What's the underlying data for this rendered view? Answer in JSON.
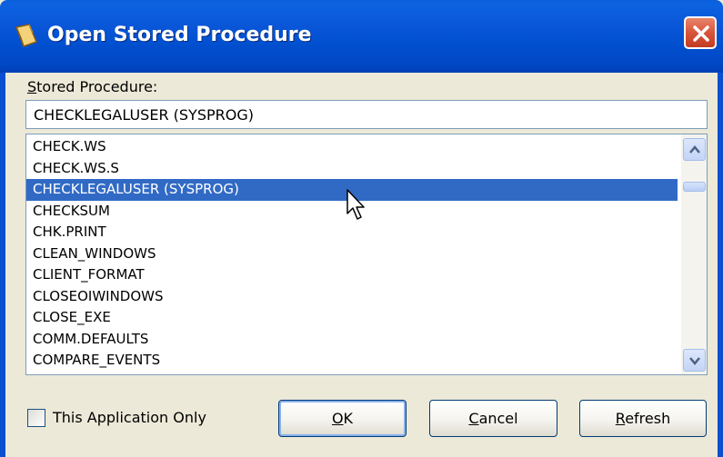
{
  "window": {
    "title": "Open Stored Procedure",
    "close_symbol": "✕"
  },
  "colors": {
    "titlebar": "#0050d0",
    "selection": "#316ac5",
    "dialog_bg": "#ece9d8",
    "close_button": "#d8553a"
  },
  "icons": {
    "title": "scroll-icon",
    "close": "close-icon",
    "scroll_up": "chevron-up-icon",
    "scroll_down": "chevron-down-icon",
    "pointer": "mouse-cursor-icon"
  },
  "stored_procedure": {
    "label_mnemonic": "S",
    "label_rest": "tored Procedure:",
    "value": "CHECKLEGALUSER (SYSPROG)"
  },
  "list": {
    "items": [
      "CHECK.WS",
      "CHECK.WS.S",
      "CHECKLEGALUSER (SYSPROG)",
      "CHECKSUM",
      "CHK.PRINT",
      "CLEAN_WINDOWS",
      "CLIENT_FORMAT",
      "CLOSEOIWINDOWS",
      "CLOSE_EXE",
      "COMM.DEFAULTS",
      "COMPARE_EVENTS"
    ],
    "selected_index": 2
  },
  "checkbox": {
    "label": "This Application Only",
    "checked": false
  },
  "buttons": {
    "ok_mnemonic": "O",
    "ok_rest": "K",
    "cancel_mnemonic": "C",
    "cancel_rest": "ancel",
    "refresh_mnemonic": "R",
    "refresh_rest": "efresh"
  }
}
